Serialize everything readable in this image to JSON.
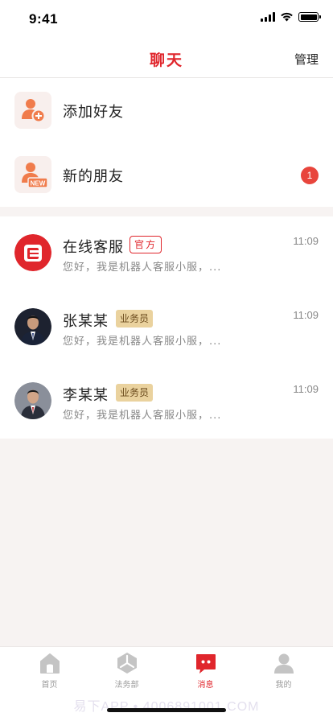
{
  "status_bar": {
    "time": "9:41"
  },
  "header": {
    "title": "聊天",
    "action_label": "管理"
  },
  "quick_actions": [
    {
      "label": "添加好友",
      "icon": "add-user-icon"
    },
    {
      "label": "新的朋友",
      "icon": "new-friend-icon",
      "badge": "1"
    }
  ],
  "new_friend_icon_text": "NEW",
  "chats": [
    {
      "name": "在线客服",
      "tag": "官方",
      "tag_type": "official",
      "time": "11:09",
      "preview": "您好，我是机器人客服小服，..."
    },
    {
      "name": "张某某",
      "tag": "业务员",
      "tag_type": "sales",
      "time": "11:09",
      "preview": "您好，我是机器人客服小服，..."
    },
    {
      "name": "李某某",
      "tag": "业务员",
      "tag_type": "sales",
      "time": "11:09",
      "preview": "您好，我是机器人客服小服，..."
    }
  ],
  "tab_bar": {
    "items": [
      {
        "label": "首页",
        "icon": "home-icon"
      },
      {
        "label": "法务部",
        "icon": "legal-icon"
      },
      {
        "label": "消息",
        "icon": "message-icon",
        "active": true
      },
      {
        "label": "我的",
        "icon": "profile-icon"
      }
    ]
  },
  "watermark": "易下APP • 4006891001.COM",
  "colors": {
    "accent": "#e0262c",
    "icon_orange": "#f07c4c",
    "badge": "#e8453c",
    "sales_tag": "#ead29e"
  }
}
